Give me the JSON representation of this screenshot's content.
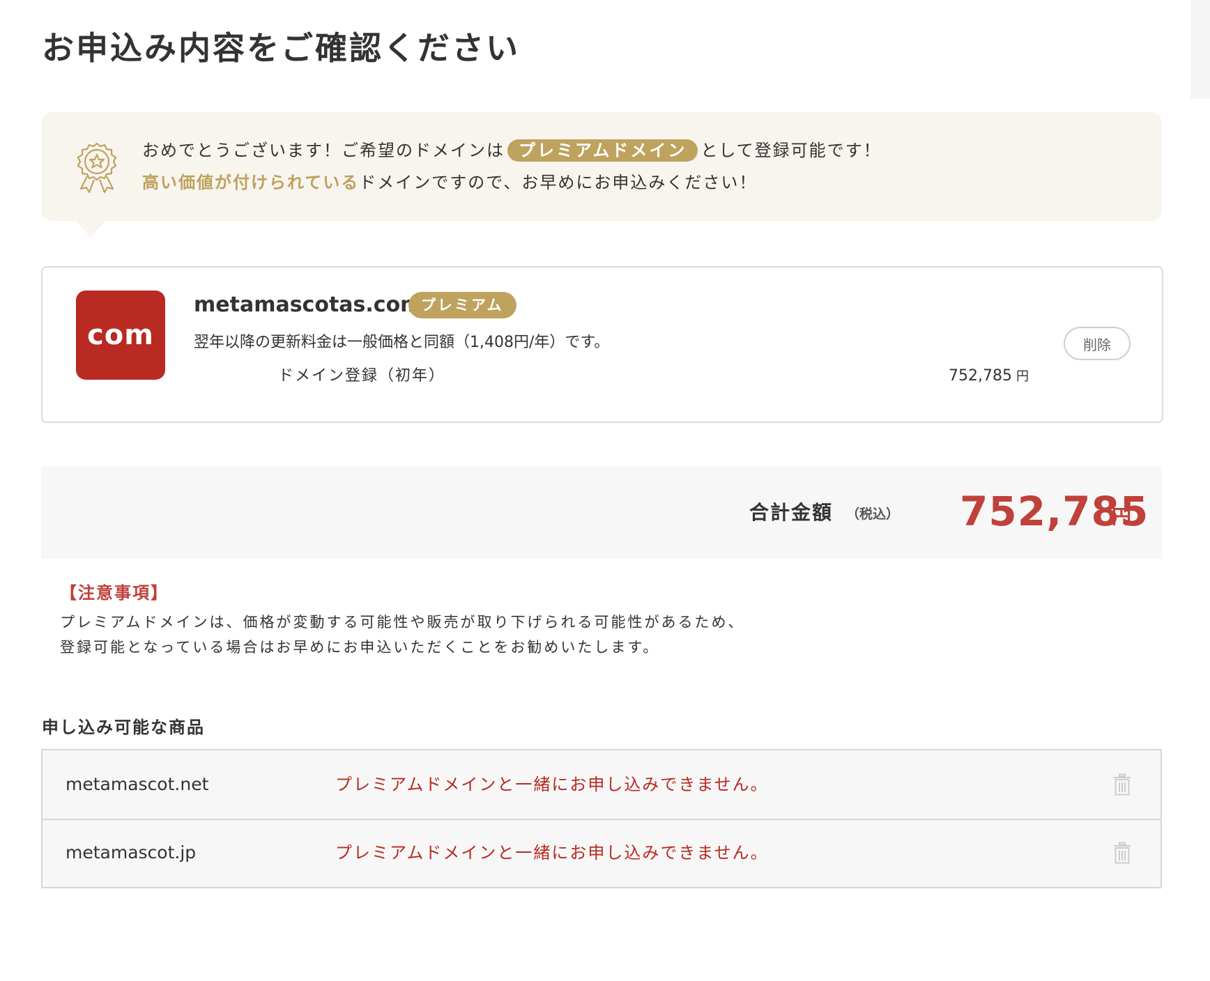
{
  "page": {
    "title": "お申込み内容をご確認ください"
  },
  "notice": {
    "icon": "award-ribbon-icon",
    "line1_before": "おめでとうございます！ご希望のドメインは",
    "line1_pill": "プレミアムドメイン",
    "line1_after": "として登録可能です！",
    "line2_highlight": "高い価値が付けられている",
    "line2_rest": "ドメインですので、お早めにお申込みください！"
  },
  "domain": {
    "tld_badge": "com",
    "name": "metamascotas.com",
    "tag": "プレミアム",
    "renewal_note": "翌年以降の更新料金は一般価格と同額（1,408円/年）です。",
    "item_label": "ドメイン登録（初年）",
    "item_price": "752,785",
    "item_currency": "円",
    "delete_label": "削除"
  },
  "total": {
    "label": "合計金額",
    "tax_note": "（税込）",
    "amount": "752,785",
    "currency": "円"
  },
  "caution": {
    "title": "【注意事項】",
    "line1": "プレミアムドメインは、価格が変動する可能性や販売が取り下げられる可能性があるため、",
    "line2": "登録可能となっている場合はお早めにお申込いただくことをお勧めいたします。"
  },
  "available_products": {
    "title": "申し込み可能な商品",
    "rows": [
      {
        "name": "metamascot.net",
        "message": "プレミアムドメインと一緒にお申し込みできません。",
        "icon": "trash-icon"
      },
      {
        "name": "metamascot.jp",
        "message": "プレミアムドメインと一緒にお申し込みできません。",
        "icon": "trash-icon"
      }
    ]
  },
  "colors": {
    "gold": "#bea25e",
    "notice_bg": "#f8f4ee",
    "tld_red": "#b82a22",
    "total_red": "#c0403a",
    "panel_gray": "#f7f7f7"
  }
}
